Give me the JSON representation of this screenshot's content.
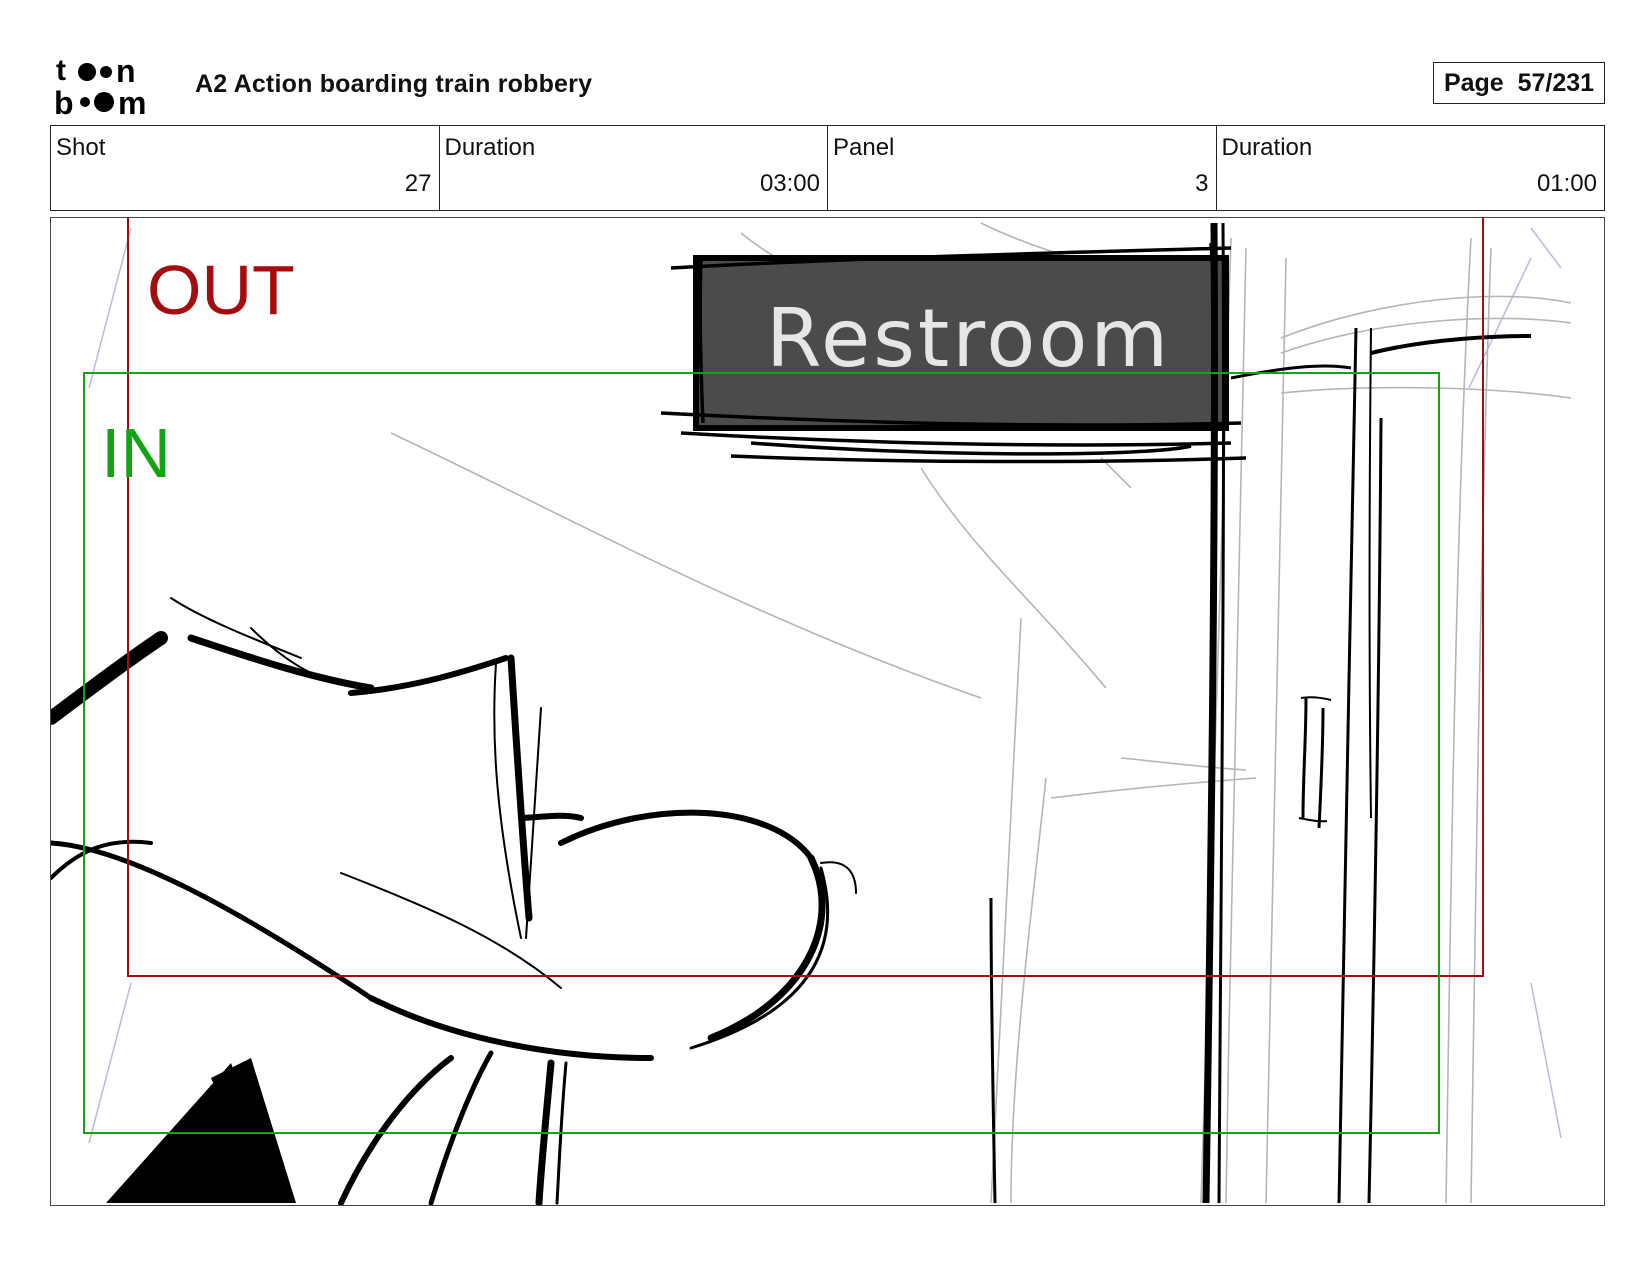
{
  "header": {
    "logo_text": "toon boom",
    "title": "A2 Action boarding train robbery",
    "page_label": "Page  57/231"
  },
  "info": {
    "shot_label": "Shot",
    "shot_value": "27",
    "shot_duration_label": "Duration",
    "shot_duration_value": "03:00",
    "panel_label": "Panel",
    "panel_value": "3",
    "panel_duration_label": "Duration",
    "panel_duration_value": "01:00"
  },
  "panel": {
    "out_label": "OUT",
    "in_label": "IN",
    "sign_text": "Restroom",
    "out_color": "#a30d0d",
    "in_color": "#13a313"
  }
}
